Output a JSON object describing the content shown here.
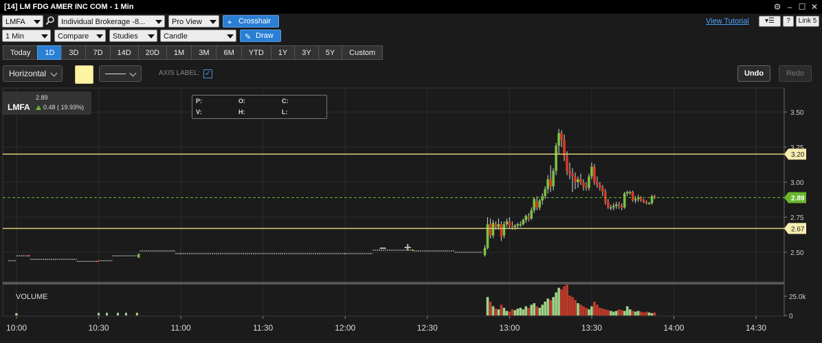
{
  "window": {
    "title": "[14] LM FDG AMER INC COM - 1 Min",
    "controls": [
      "⚙",
      "–",
      "☐",
      "✕"
    ]
  },
  "toolbar": {
    "symbol": "LMFA",
    "account": "Individual Brokerage -8...",
    "view": "Pro View",
    "crosshair_label": "Crosshair",
    "view_tutorial": "View Tutorial",
    "help": "?",
    "link": "Link 5",
    "interval": "1 Min",
    "compare": "Compare",
    "studies": "Studies",
    "chart_type": "Candle",
    "draw_label": "Draw"
  },
  "ranges": [
    "Today",
    "1D",
    "3D",
    "7D",
    "14D",
    "20D",
    "1M",
    "3M",
    "6M",
    "YTD",
    "1Y",
    "3Y",
    "5Y",
    "Custom"
  ],
  "active_range": "1D",
  "draw_tools": {
    "line_type": "Horizontal",
    "color": "#fdf3a0",
    "axis_label": "AXIS LABEL:",
    "axis_label_checked": true,
    "undo": "Undo",
    "redo": "Redo"
  },
  "quote": {
    "symbol": "LMFA",
    "price": "2.89",
    "change": "0.48 ( 19.93%)"
  },
  "ohlc": {
    "p": "P:",
    "o": "O:",
    "c": "C:",
    "v": "V:",
    "h": "H:",
    "l": "L:"
  },
  "volume_label": "VOLUME",
  "zoom": {
    "minus": "–",
    "plus": "+"
  },
  "chart_data": {
    "type": "candlestick",
    "x_labels": [
      "10:00",
      "10:30",
      "11:00",
      "11:30",
      "12:00",
      "12:30",
      "13:00",
      "13:30",
      "14:00",
      "14:30"
    ],
    "y_ticks": [
      "3.50",
      "3.25",
      "3.00",
      "2.75",
      "2.50"
    ],
    "ylim": [
      2.3,
      3.6
    ],
    "volume_ticks": [
      "25.0k",
      "0"
    ],
    "last_price": "2.89",
    "horizontal_lines": [
      {
        "value": 3.2,
        "label": "3.20"
      },
      {
        "value": 2.67,
        "label": "2.67"
      }
    ],
    "colors": {
      "up": "#7cc242",
      "down": "#d93a1f",
      "line": "#d9cf7a",
      "last": "#6ab82e",
      "vol_up": "#9fd28a",
      "vol_down": "#c23a2a"
    },
    "segments": [
      {
        "t0": "09:57",
        "t1": "10:00",
        "o": 2.44,
        "c": 2.44
      },
      {
        "t0": "10:00",
        "t1": "10:05",
        "o": 2.48,
        "c": 2.47
      },
      {
        "t0": "10:05",
        "t1": "10:22",
        "o": 2.45,
        "c": 2.45
      },
      {
        "t0": "10:22",
        "t1": "10:30",
        "o": 2.44,
        "c": 2.43
      },
      {
        "t0": "10:30",
        "t1": "10:35",
        "o": 2.44,
        "c": 2.44
      },
      {
        "t0": "10:35",
        "t1": "10:45",
        "o": 2.46,
        "c": 2.49
      },
      {
        "t0": "10:45",
        "t1": "10:58",
        "o": 2.51,
        "c": 2.51
      },
      {
        "t0": "10:58",
        "t1": "11:00",
        "o": 2.49,
        "c": 2.49
      },
      {
        "t0": "11:00",
        "t1": "12:00",
        "o": 2.49,
        "c": 2.49
      },
      {
        "t0": "12:00",
        "t1": "12:10",
        "o": 2.49,
        "c": 2.49
      },
      {
        "t0": "12:10",
        "t1": "12:25",
        "o": 2.51,
        "c": 2.52
      },
      {
        "t0": "12:25",
        "t1": "12:40",
        "o": 2.51,
        "c": 2.51
      },
      {
        "t0": "12:40",
        "t1": "12:50",
        "o": 2.5,
        "c": 2.5
      }
    ],
    "candles": [
      {
        "t": "12:51",
        "o": 2.48,
        "h": 2.55,
        "l": 2.47,
        "c": 2.53
      },
      {
        "t": "12:52",
        "o": 2.53,
        "h": 2.75,
        "l": 2.52,
        "c": 2.7
      },
      {
        "t": "12:53",
        "o": 2.7,
        "h": 2.74,
        "l": 2.6,
        "c": 2.62
      },
      {
        "t": "12:54",
        "o": 2.62,
        "h": 2.73,
        "l": 2.6,
        "c": 2.71
      },
      {
        "t": "12:55",
        "o": 2.7,
        "h": 2.72,
        "l": 2.66,
        "c": 2.68
      },
      {
        "t": "12:56",
        "o": 2.68,
        "h": 2.74,
        "l": 2.66,
        "c": 2.7
      },
      {
        "t": "12:57",
        "o": 2.7,
        "h": 2.72,
        "l": 2.58,
        "c": 2.61
      },
      {
        "t": "12:58",
        "o": 2.62,
        "h": 2.72,
        "l": 2.6,
        "c": 2.7
      },
      {
        "t": "12:59",
        "o": 2.7,
        "h": 2.74,
        "l": 2.68,
        "c": 2.72
      },
      {
        "t": "13:00",
        "o": 2.72,
        "h": 2.75,
        "l": 2.67,
        "c": 2.69
      },
      {
        "t": "13:01",
        "o": 2.69,
        "h": 2.72,
        "l": 2.66,
        "c": 2.68
      },
      {
        "t": "13:02",
        "o": 2.68,
        "h": 2.7,
        "l": 2.66,
        "c": 2.69
      },
      {
        "t": "13:03",
        "o": 2.69,
        "h": 2.71,
        "l": 2.67,
        "c": 2.7
      },
      {
        "t": "13:04",
        "o": 2.7,
        "h": 2.72,
        "l": 2.68,
        "c": 2.7
      },
      {
        "t": "13:05",
        "o": 2.7,
        "h": 2.74,
        "l": 2.69,
        "c": 2.73
      },
      {
        "t": "13:06",
        "o": 2.73,
        "h": 2.77,
        "l": 2.71,
        "c": 2.76
      },
      {
        "t": "13:07",
        "o": 2.75,
        "h": 2.78,
        "l": 2.72,
        "c": 2.74
      },
      {
        "t": "13:08",
        "o": 2.74,
        "h": 2.82,
        "l": 2.73,
        "c": 2.8
      },
      {
        "t": "13:09",
        "o": 2.8,
        "h": 2.89,
        "l": 2.78,
        "c": 2.88
      },
      {
        "t": "13:10",
        "o": 2.86,
        "h": 2.9,
        "l": 2.8,
        "c": 2.82
      },
      {
        "t": "13:11",
        "o": 2.82,
        "h": 2.88,
        "l": 2.8,
        "c": 2.87
      },
      {
        "t": "13:12",
        "o": 2.87,
        "h": 2.92,
        "l": 2.84,
        "c": 2.9
      },
      {
        "t": "13:13",
        "o": 2.9,
        "h": 2.97,
        "l": 2.88,
        "c": 2.95
      },
      {
        "t": "13:14",
        "o": 2.95,
        "h": 3.05,
        "l": 2.92,
        "c": 3.02
      },
      {
        "t": "13:15",
        "o": 3.02,
        "h": 3.12,
        "l": 2.93,
        "c": 2.97
      },
      {
        "t": "13:16",
        "o": 2.97,
        "h": 3.1,
        "l": 2.94,
        "c": 3.08
      },
      {
        "t": "13:17",
        "o": 3.08,
        "h": 3.28,
        "l": 3.05,
        "c": 3.26
      },
      {
        "t": "13:18",
        "o": 3.26,
        "h": 3.38,
        "l": 3.2,
        "c": 3.35
      },
      {
        "t": "13:19",
        "o": 3.35,
        "h": 3.37,
        "l": 3.25,
        "c": 3.3
      },
      {
        "t": "13:20",
        "o": 3.3,
        "h": 3.34,
        "l": 3.15,
        "c": 3.18
      },
      {
        "t": "13:21",
        "o": 3.18,
        "h": 3.22,
        "l": 3.05,
        "c": 3.08
      },
      {
        "t": "13:22",
        "o": 3.08,
        "h": 3.14,
        "l": 3.02,
        "c": 3.06
      },
      {
        "t": "13:23",
        "o": 3.06,
        "h": 3.1,
        "l": 2.93,
        "c": 3.04
      },
      {
        "t": "13:24",
        "o": 3.04,
        "h": 3.07,
        "l": 2.95,
        "c": 3.0
      },
      {
        "t": "13:25",
        "o": 3.0,
        "h": 3.04,
        "l": 2.96,
        "c": 3.02
      },
      {
        "t": "13:26",
        "o": 3.02,
        "h": 3.06,
        "l": 2.98,
        "c": 3.0
      },
      {
        "t": "13:27",
        "o": 3.0,
        "h": 3.02,
        "l": 2.94,
        "c": 2.97
      },
      {
        "t": "13:28",
        "o": 2.97,
        "h": 3.0,
        "l": 2.94,
        "c": 2.96
      },
      {
        "t": "13:29",
        "o": 2.96,
        "h": 3.06,
        "l": 2.94,
        "c": 3.04
      },
      {
        "t": "13:30",
        "o": 3.04,
        "h": 3.14,
        "l": 3.02,
        "c": 3.11
      },
      {
        "t": "13:31",
        "o": 3.11,
        "h": 3.13,
        "l": 2.98,
        "c": 3.0
      },
      {
        "t": "13:32",
        "o": 3.0,
        "h": 3.04,
        "l": 2.96,
        "c": 2.98
      },
      {
        "t": "13:33",
        "o": 2.98,
        "h": 3.0,
        "l": 2.94,
        "c": 2.96
      },
      {
        "t": "13:34",
        "o": 2.96,
        "h": 2.98,
        "l": 2.9,
        "c": 2.93
      },
      {
        "t": "13:35",
        "o": 2.93,
        "h": 2.95,
        "l": 2.84,
        "c": 2.86
      },
      {
        "t": "13:36",
        "o": 2.86,
        "h": 2.88,
        "l": 2.81,
        "c": 2.82
      },
      {
        "t": "13:37",
        "o": 2.82,
        "h": 2.84,
        "l": 2.8,
        "c": 2.82
      },
      {
        "t": "13:38",
        "o": 2.82,
        "h": 2.85,
        "l": 2.8,
        "c": 2.83
      },
      {
        "t": "13:39",
        "o": 2.83,
        "h": 2.86,
        "l": 2.81,
        "c": 2.84
      },
      {
        "t": "13:40",
        "o": 2.84,
        "h": 2.86,
        "l": 2.81,
        "c": 2.83
      },
      {
        "t": "13:41",
        "o": 2.83,
        "h": 2.85,
        "l": 2.8,
        "c": 2.82
      },
      {
        "t": "13:42",
        "o": 2.82,
        "h": 2.93,
        "l": 2.81,
        "c": 2.92
      },
      {
        "t": "13:43",
        "o": 2.92,
        "h": 2.94,
        "l": 2.9,
        "c": 2.93
      },
      {
        "t": "13:44",
        "o": 2.93,
        "h": 2.94,
        "l": 2.91,
        "c": 2.93
      },
      {
        "t": "13:45",
        "o": 2.93,
        "h": 2.94,
        "l": 2.86,
        "c": 2.87
      },
      {
        "t": "13:46",
        "o": 2.87,
        "h": 2.9,
        "l": 2.85,
        "c": 2.88
      },
      {
        "t": "13:47",
        "o": 2.88,
        "h": 2.91,
        "l": 2.86,
        "c": 2.89
      },
      {
        "t": "13:48",
        "o": 2.89,
        "h": 2.9,
        "l": 2.86,
        "c": 2.87
      },
      {
        "t": "13:49",
        "o": 2.87,
        "h": 2.88,
        "l": 2.85,
        "c": 2.86
      },
      {
        "t": "13:50",
        "o": 2.86,
        "h": 2.87,
        "l": 2.84,
        "c": 2.85
      },
      {
        "t": "13:51",
        "o": 2.85,
        "h": 2.86,
        "l": 2.84,
        "c": 2.85
      },
      {
        "t": "13:52",
        "o": 2.85,
        "h": 2.91,
        "l": 2.84,
        "c": 2.9
      },
      {
        "t": "13:53",
        "o": 2.9,
        "h": 2.91,
        "l": 2.88,
        "c": 2.89
      }
    ],
    "volume": [
      3,
      24,
      18,
      12,
      9,
      8,
      14,
      10,
      6,
      5,
      8,
      7,
      9,
      10,
      8,
      12,
      10,
      14,
      16,
      12,
      10,
      14,
      18,
      22,
      20,
      24,
      30,
      36,
      34,
      38,
      42,
      26,
      24,
      20,
      16,
      14,
      12,
      10,
      8,
      12,
      18,
      14,
      10,
      9,
      8,
      7,
      6,
      5,
      6,
      8,
      7,
      6,
      12,
      8,
      6,
      5,
      6,
      5,
      4,
      5,
      4,
      3,
      4,
      3
    ]
  }
}
